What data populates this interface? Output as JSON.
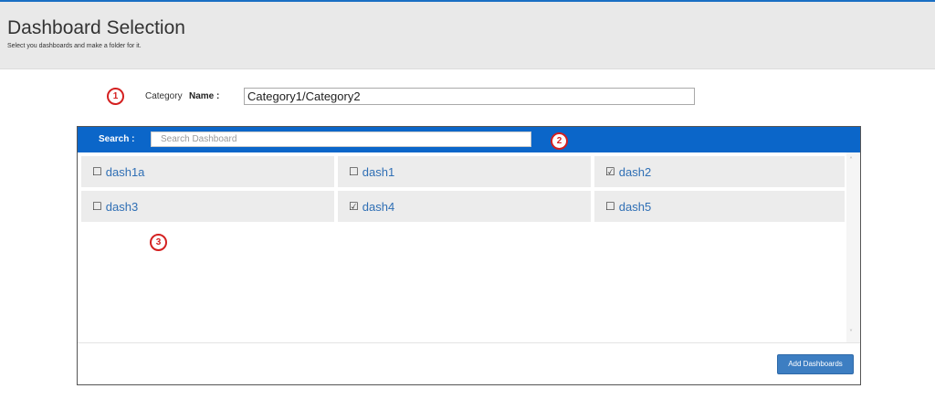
{
  "header": {
    "title": "Dashboard Selection",
    "subtitle": "Select you dashboards and make a folder for it."
  },
  "markers": [
    "1",
    "2",
    "3"
  ],
  "category": {
    "label": "Category",
    "name_label": "Name :",
    "value": "Category1/Category2"
  },
  "search": {
    "label": "Search :",
    "placeholder": "Search Dashboard",
    "value": ""
  },
  "dashboards": [
    {
      "name": "dash1a",
      "checked": false
    },
    {
      "name": "dash1",
      "checked": false
    },
    {
      "name": "dash2",
      "checked": true
    },
    {
      "name": "dash3",
      "checked": false
    },
    {
      "name": "dash4",
      "checked": true
    },
    {
      "name": "dash5",
      "checked": false
    }
  ],
  "checkbox_glyphs": {
    "checked": "☑",
    "unchecked": "☐"
  },
  "scrollbar": {
    "up": "˄",
    "down": "˅"
  },
  "actions": {
    "add_label": "Add Dashboards"
  },
  "colors": {
    "header_bar": "#0b66c9",
    "button": "#3d7ec2",
    "marker": "#d42020",
    "link": "#2f6fb5"
  }
}
